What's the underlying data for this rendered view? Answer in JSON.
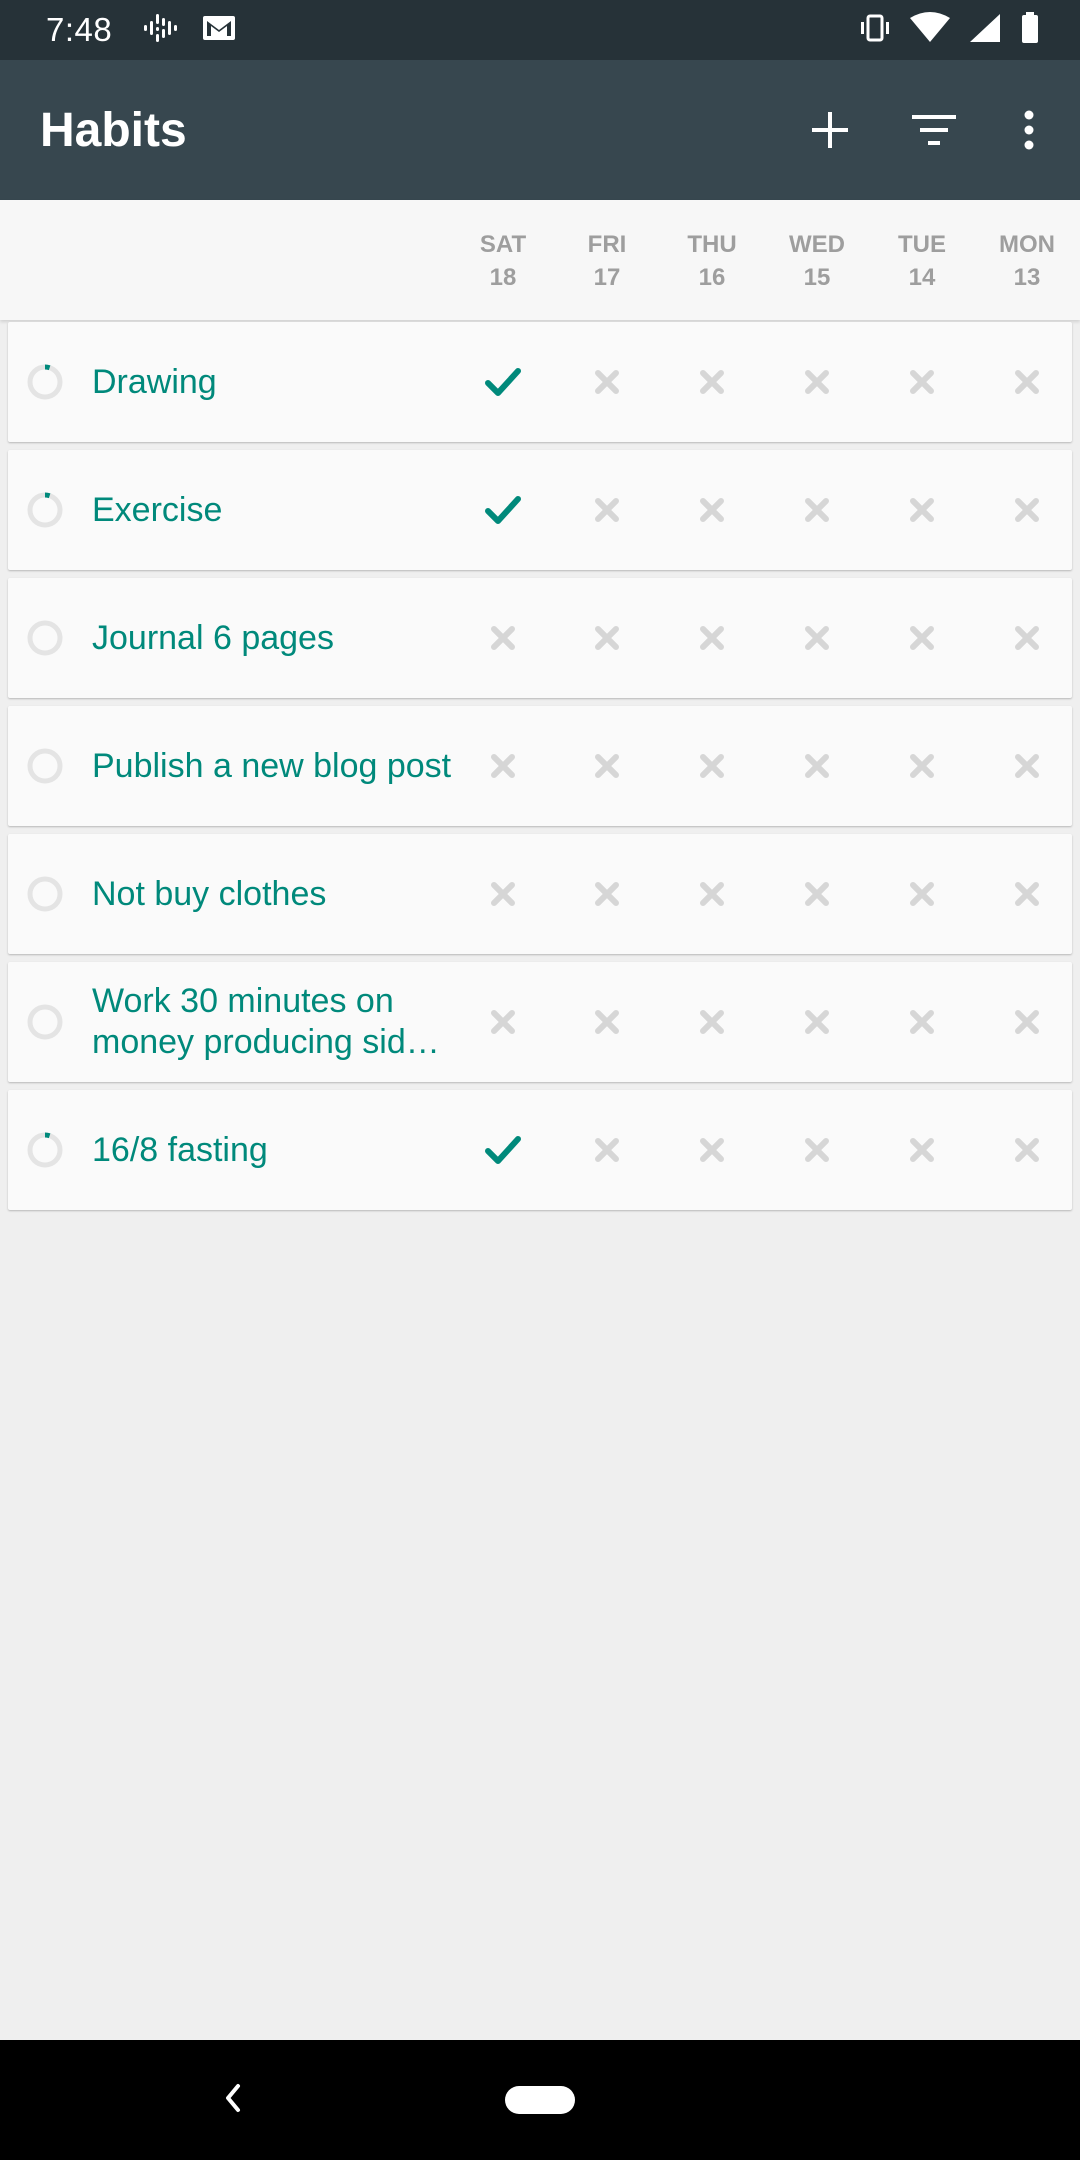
{
  "status_bar": {
    "time": "7:48",
    "left_icons": [
      "podcast-icon",
      "gmail-icon"
    ],
    "right_icons": [
      "vibrate-icon",
      "wifi-icon",
      "signal-icon",
      "battery-icon"
    ]
  },
  "app_bar": {
    "title": "Habits",
    "actions": [
      "add-icon",
      "filter-icon",
      "more-vert-icon"
    ]
  },
  "days": [
    {
      "weekday": "SAT",
      "day": "18"
    },
    {
      "weekday": "FRI",
      "day": "17"
    },
    {
      "weekday": "THU",
      "day": "16"
    },
    {
      "weekday": "WED",
      "day": "15"
    },
    {
      "weekday": "TUE",
      "day": "14"
    },
    {
      "weekday": "MON",
      "day": "13"
    }
  ],
  "habits": [
    {
      "name": "Drawing",
      "score": 0.05,
      "checks": [
        true,
        false,
        false,
        false,
        false,
        false
      ]
    },
    {
      "name": "Exercise",
      "score": 0.05,
      "checks": [
        true,
        false,
        false,
        false,
        false,
        false
      ]
    },
    {
      "name": "Journal 6 pages",
      "score": 0,
      "checks": [
        false,
        false,
        false,
        false,
        false,
        false
      ]
    },
    {
      "name": "Publish a new blog post",
      "score": 0,
      "checks": [
        false,
        false,
        false,
        false,
        false,
        false
      ]
    },
    {
      "name": "Not buy clothes",
      "score": 0,
      "checks": [
        false,
        false,
        false,
        false,
        false,
        false
      ]
    },
    {
      "name": "Work 30 minutes on money producing sid…",
      "score": 0,
      "checks": [
        false,
        false,
        false,
        false,
        false,
        false
      ]
    },
    {
      "name": "16/8 fasting",
      "score": 0.05,
      "checks": [
        true,
        false,
        false,
        false,
        false,
        false
      ]
    }
  ],
  "colors": {
    "status_bar": "#263238",
    "app_bar": "#37474f",
    "accent": "#00897b",
    "unchecked": "#d6d6d6",
    "ring_track": "#e4e4e4",
    "background": "#efefef",
    "card": "#fafafa",
    "day_label": "#9e9e9e"
  },
  "nav_bar": {
    "icons": [
      "back-icon",
      "home-pill-icon"
    ]
  }
}
